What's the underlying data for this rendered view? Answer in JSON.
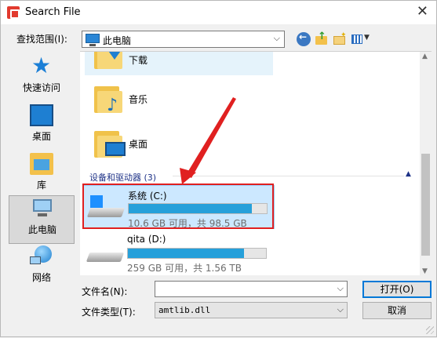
{
  "window": {
    "title": "Search File",
    "close_glyph": "✕"
  },
  "toolbar": {
    "lookin_label": "查找范围(I):",
    "lookin_value": "此电脑",
    "icons": [
      "back-icon",
      "up-folder-icon",
      "new-folder-icon",
      "view-menu-icon"
    ]
  },
  "places": [
    {
      "label": "快速访问",
      "icon": "quick-access-star-icon"
    },
    {
      "label": "桌面",
      "icon": "desktop-icon"
    },
    {
      "label": "库",
      "icon": "library-icon"
    },
    {
      "label": "此电脑",
      "icon": "this-pc-icon",
      "selected": true
    },
    {
      "label": "网络",
      "icon": "network-icon"
    }
  ],
  "folders": [
    {
      "label": "下载",
      "icon": "downloads-folder-icon"
    },
    {
      "label": "音乐",
      "icon": "music-folder-icon"
    },
    {
      "label": "桌面",
      "icon": "desktop-folder-icon"
    }
  ],
  "devices_group": {
    "header": "设备和驱动器 (3)"
  },
  "drives": [
    {
      "name": "系统 (C:)",
      "free_text": "10.6 GB 可用，共 98.5 GB",
      "used_fraction": 0.89,
      "selected": true
    },
    {
      "name": "qita (D:)",
      "free_text": "259 GB 可用，共 1.56 TB",
      "used_fraction": 0.84,
      "selected": false
    }
  ],
  "footer": {
    "filename_label": "文件名(N):",
    "filename_value": "",
    "filetype_label": "文件类型(T):",
    "filetype_value": "amtlib.dll",
    "open_label": "打开(O)",
    "cancel_label": "取消"
  },
  "colors": {
    "accent": "#0078d7",
    "drive_bar": "#26a0da",
    "annotation_red": "#e02020"
  }
}
